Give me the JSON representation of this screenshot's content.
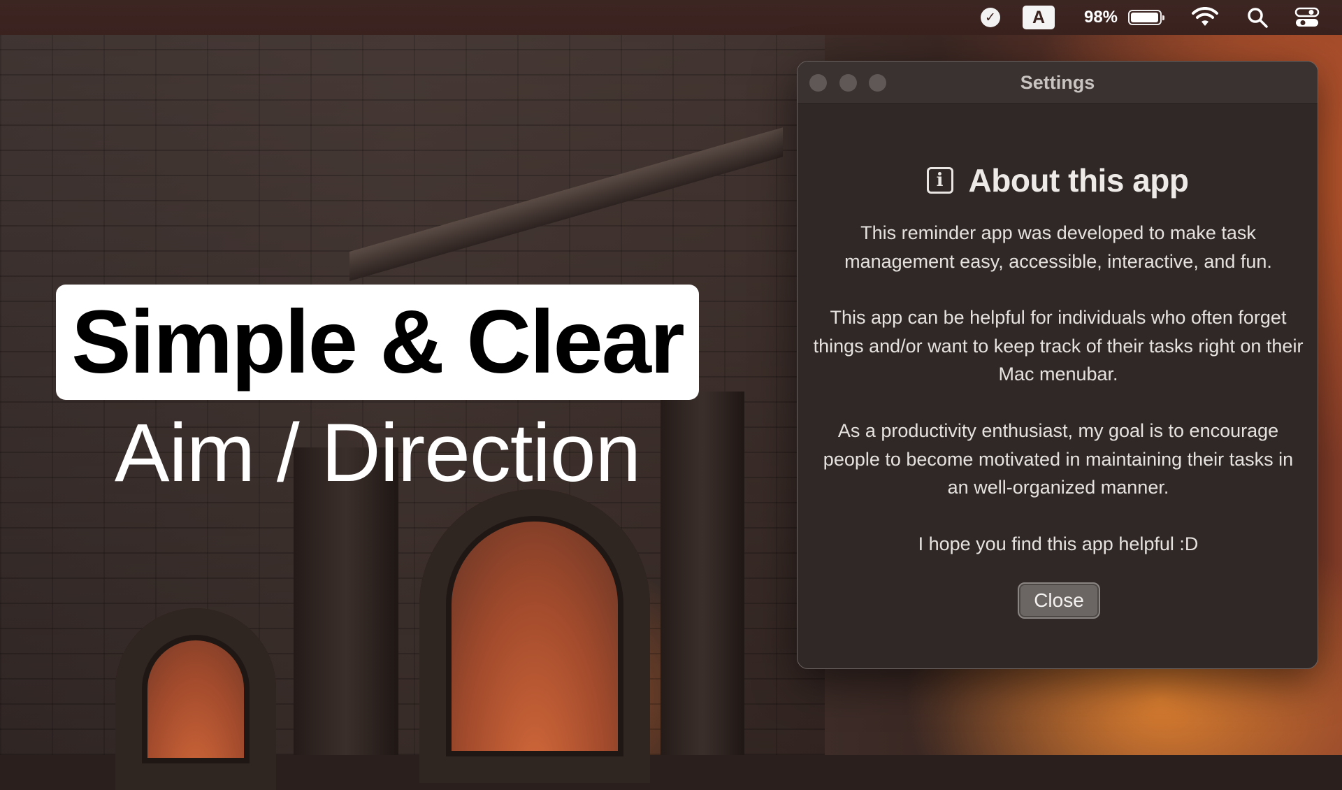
{
  "menubar": {
    "items": [
      {
        "name": "task-check-icon",
        "glyph": "✓"
      },
      {
        "name": "input-source-icon",
        "glyph": "A"
      }
    ],
    "battery": {
      "percent_label": "98%",
      "level": 0.98
    },
    "icons": [
      "wifi-icon",
      "search-icon",
      "control-center-icon"
    ]
  },
  "overlay": {
    "headline": "Simple & Clear",
    "subhead": "Aim / Direction"
  },
  "window": {
    "title": "Settings",
    "about": {
      "icon": "info-icon",
      "icon_glyph": "i",
      "title": "About this app",
      "paragraphs": [
        "This reminder app was developed to make task management easy, accessible, interactive, and fun.",
        "This app can be helpful for individuals who often forget things and/or want to keep track of their tasks right on their Mac menubar.",
        "As a productivity enthusiast, my goal is to encourage people to become motivated in maintaining their tasks in an well-organized manner.",
        "I hope you find this app helpful :D"
      ]
    },
    "close_label": "Close"
  },
  "colors": {
    "menubar": "#3a221f",
    "window_bg": "#2f2826",
    "button_bg": "#6b6563",
    "headline_box": "#ffffff"
  }
}
